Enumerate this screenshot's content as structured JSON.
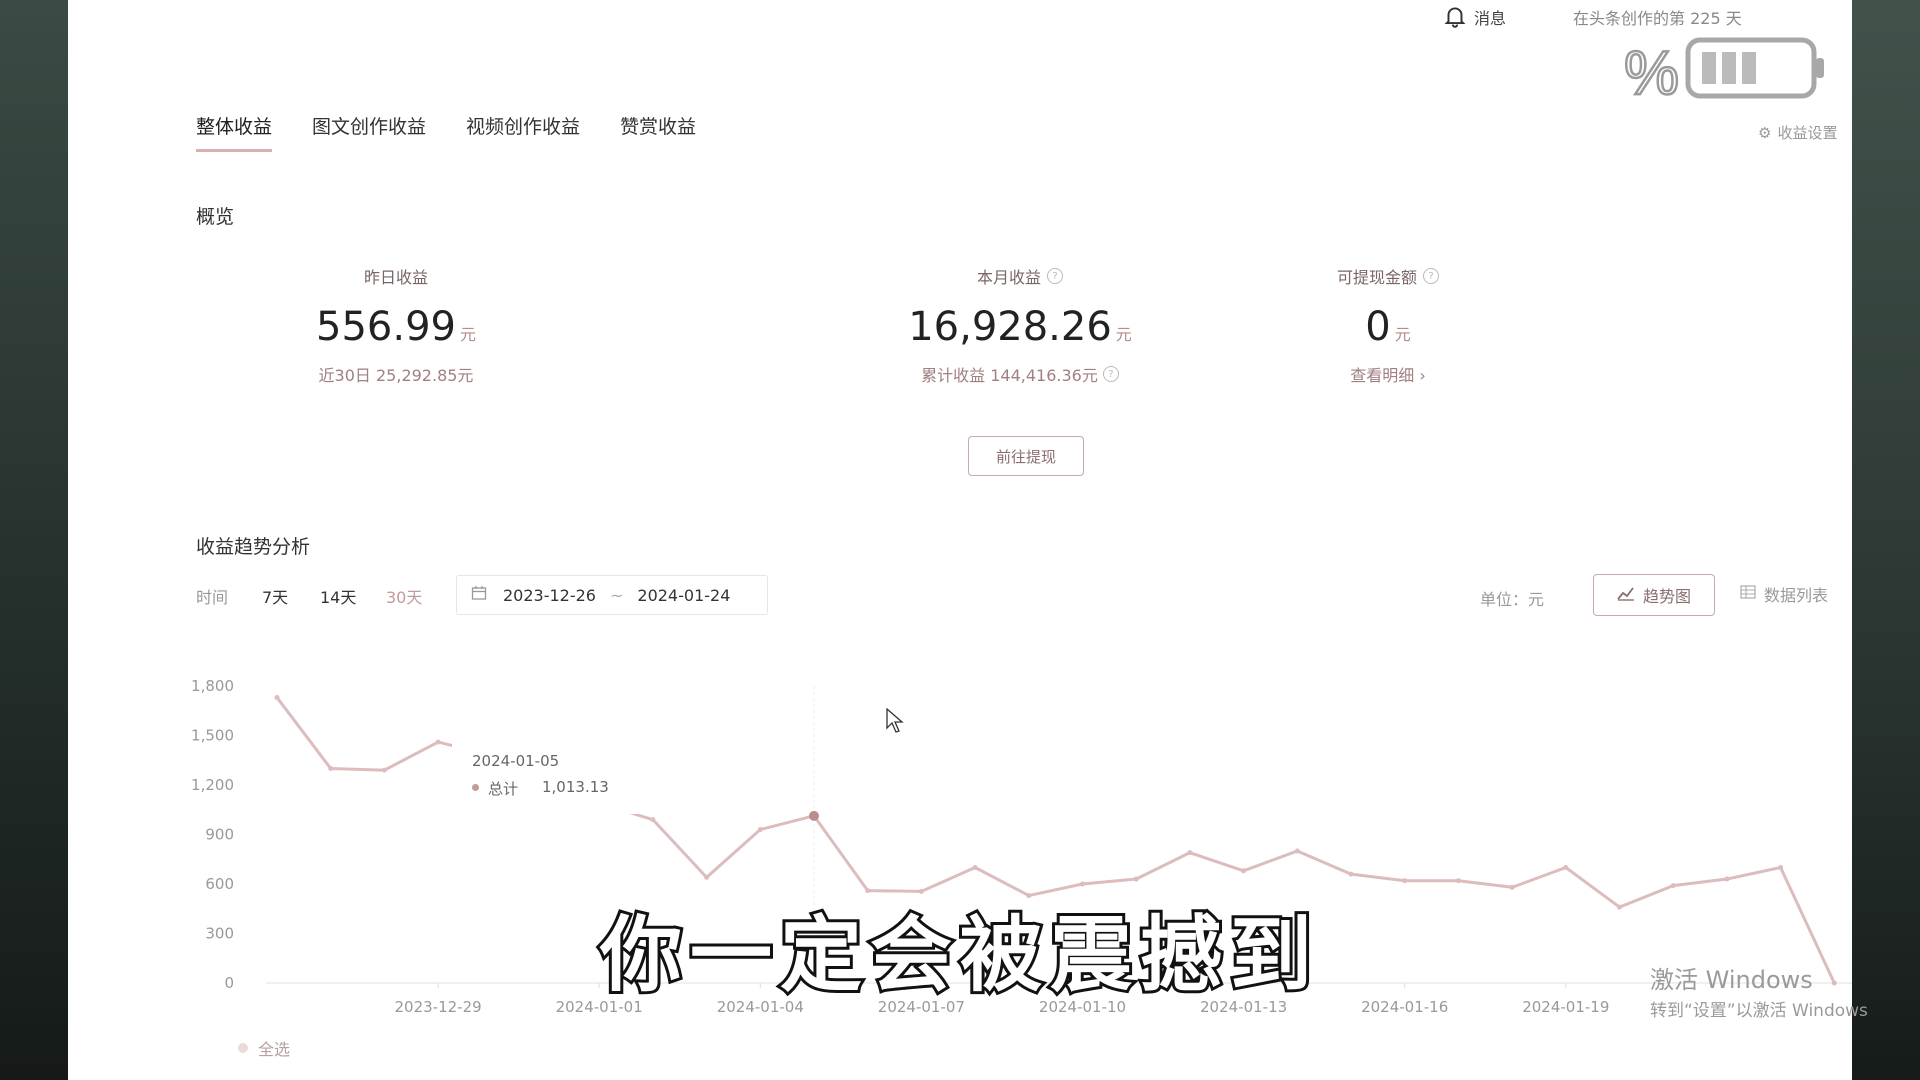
{
  "topbar": {
    "messages_label": "消息",
    "days_text": "在头条创作的第 225 天",
    "income_settings_label": "收益设置"
  },
  "tabs": [
    {
      "label": "整体收益",
      "active": true
    },
    {
      "label": "图文创作收益",
      "active": false
    },
    {
      "label": "视频创作收益",
      "active": false
    },
    {
      "label": "赞赏收益",
      "active": false
    }
  ],
  "overview": {
    "title": "概览",
    "yesterday": {
      "label": "昨日收益",
      "value": "556.99",
      "unit": "元",
      "sub": "近30日 25,292.85元"
    },
    "month": {
      "label": "本月收益",
      "value": "16,928.26",
      "unit": "元",
      "sub": "累计收益 144,416.36元"
    },
    "withdrawable": {
      "label": "可提现金额",
      "value": "0",
      "unit": "元",
      "sub": "查看明细 ›"
    },
    "withdraw_button": "前往提现"
  },
  "trend": {
    "title": "收益趋势分析",
    "time_label": "时间",
    "ranges": [
      "7天",
      "14天",
      "30天"
    ],
    "active_range": "30天",
    "start_date": "2023-12-26",
    "separator": "~",
    "end_date": "2024-01-24",
    "unit_label": "单位：元",
    "view_trend": "趋势图",
    "view_table": "数据列表",
    "select_all": "全选"
  },
  "tooltip": {
    "date": "2024-01-05",
    "series": "总计",
    "value": "1,013.13"
  },
  "colors": {
    "accent": "#c49a9a",
    "line": "#dcbcbc",
    "subtitle": "#ffffff"
  },
  "chart_data": {
    "type": "line",
    "y_ticks": [
      "1,800",
      "1,500",
      "1,200",
      "900",
      "600",
      "300",
      "0"
    ],
    "x_tick_labels": [
      "2023-12-29",
      "2024-01-01",
      "2024-01-04",
      "2024-01-07",
      "2024-01-10",
      "2024-01-13",
      "2024-01-16",
      "2024-01-19"
    ],
    "ylim": [
      0,
      1800
    ],
    "categories": [
      "2023-12-26",
      "2023-12-27",
      "2023-12-28",
      "2023-12-29",
      "2023-12-30",
      "2023-12-31",
      "2024-01-01",
      "2024-01-02",
      "2024-01-03",
      "2024-01-04",
      "2024-01-05",
      "2024-01-06",
      "2024-01-07",
      "2024-01-08",
      "2024-01-09",
      "2024-01-10",
      "2024-01-11",
      "2024-01-12",
      "2024-01-13",
      "2024-01-14",
      "2024-01-15",
      "2024-01-16",
      "2024-01-17",
      "2024-01-18",
      "2024-01-19",
      "2024-01-20",
      "2024-01-21",
      "2024-01-22",
      "2024-01-23",
      "2024-01-24"
    ],
    "series": [
      {
        "name": "总计",
        "values": [
          1730,
          1300,
          1290,
          1460,
          1380,
          1150,
          1090,
          990,
          640,
          930,
          1013,
          560,
          555,
          700,
          530,
          600,
          630,
          790,
          680,
          800,
          660,
          620,
          620,
          580,
          700,
          460,
          590,
          630,
          700,
          0
        ]
      }
    ]
  },
  "subtitle": "你一定会被震撼到",
  "watermark": {
    "title": "激活 Windows",
    "sub": "转到“设置”以激活 Windows"
  }
}
